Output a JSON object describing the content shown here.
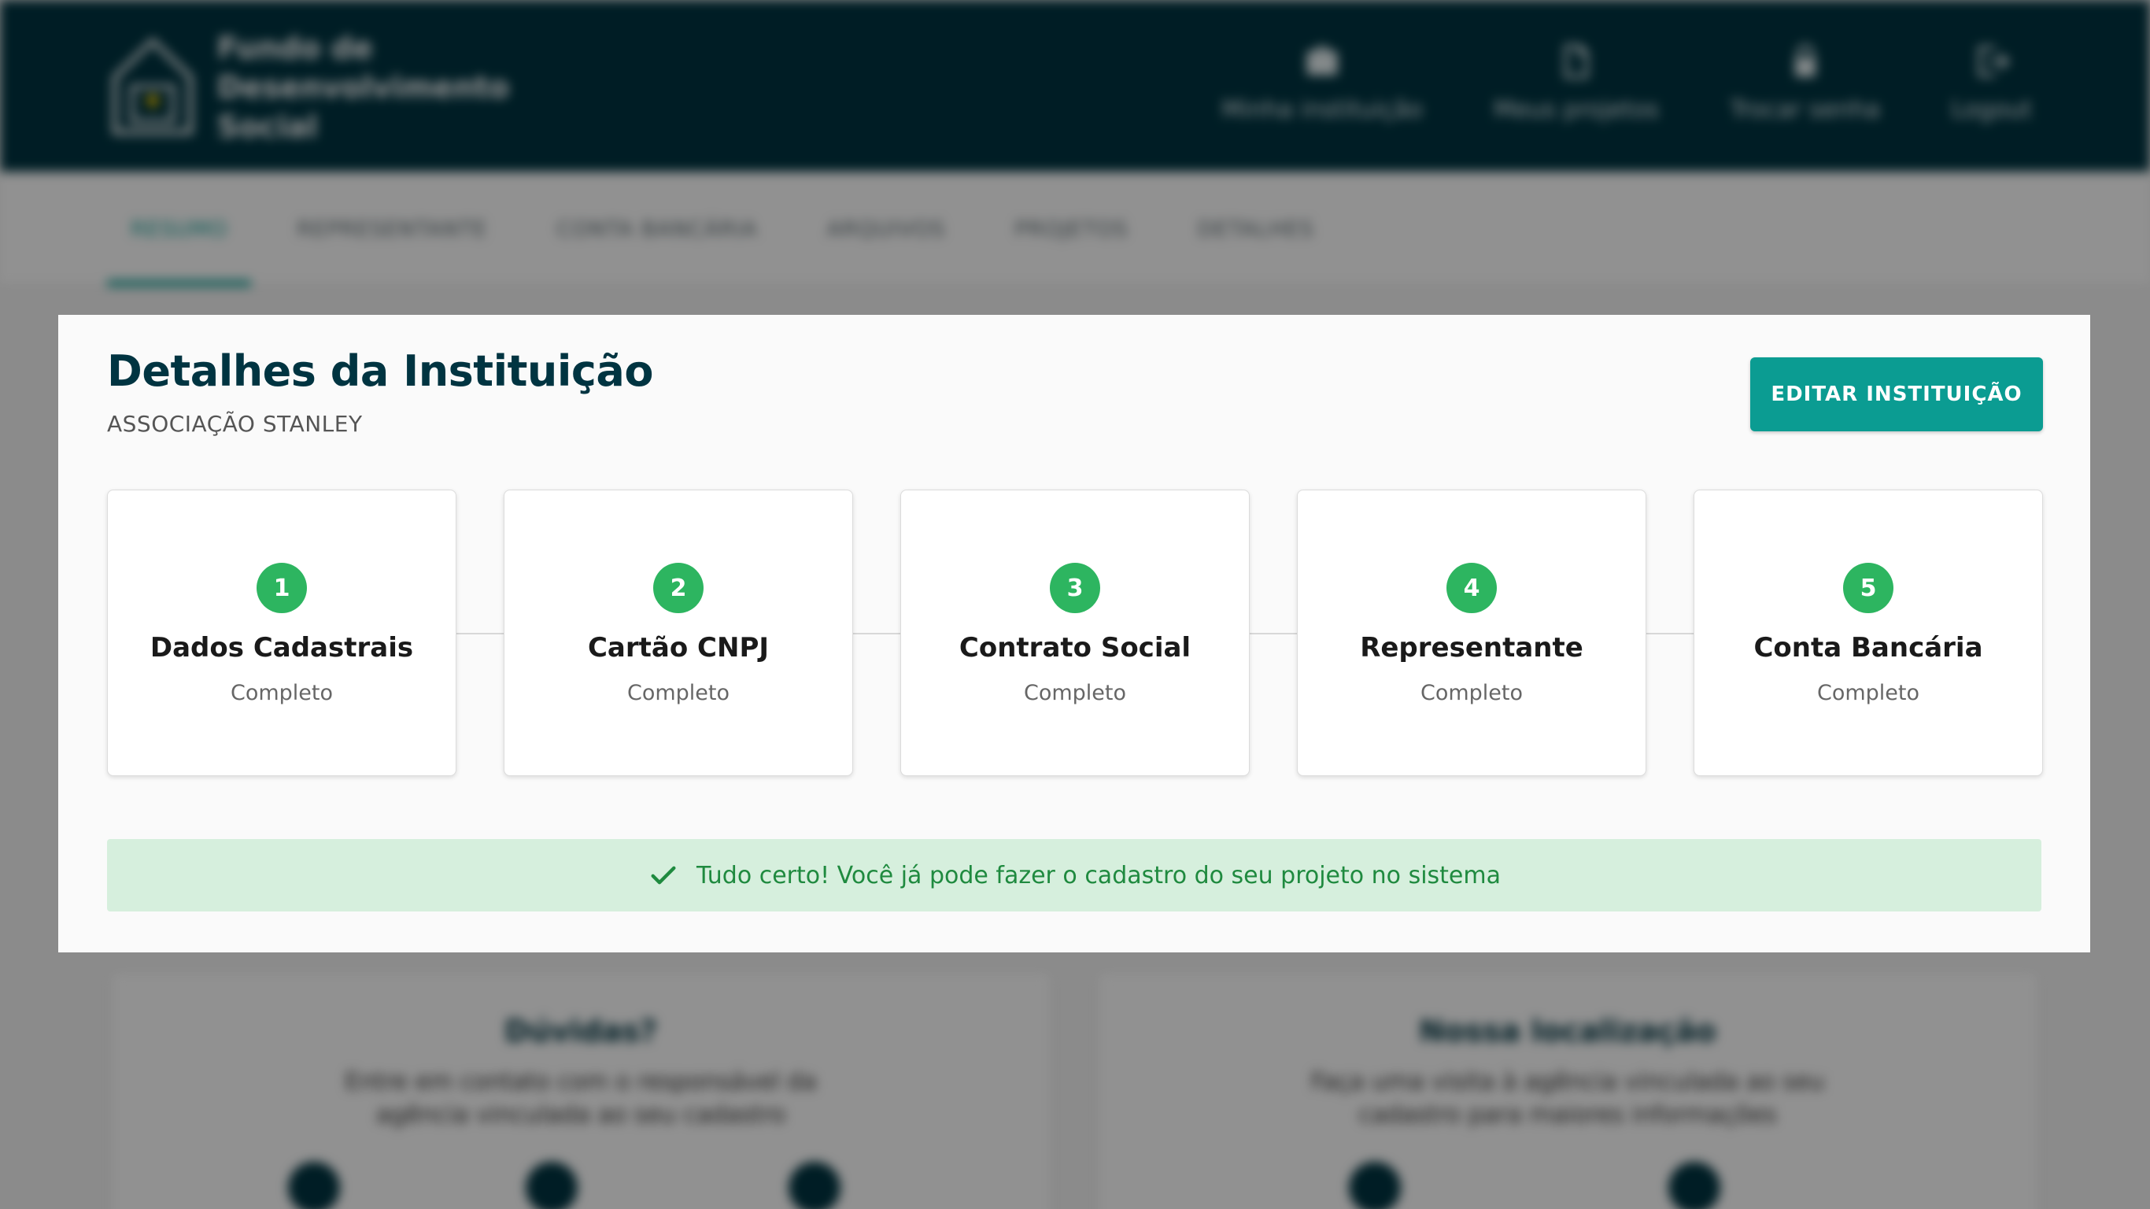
{
  "app": {
    "logo_text": "Fundo de Desenvolvimento Social",
    "top_nav": [
      {
        "label": "Minha instituição",
        "icon": "briefcase-icon"
      },
      {
        "label": "Meus projetos",
        "icon": "document-icon"
      },
      {
        "label": "Trocar senha",
        "icon": "lock-icon"
      },
      {
        "label": "Logout",
        "icon": "logout-icon"
      }
    ]
  },
  "tabs": [
    {
      "label": "Resumo",
      "active": true
    },
    {
      "label": "Representante",
      "active": false
    },
    {
      "label": "Conta bancária",
      "active": false
    },
    {
      "label": "Arquivos",
      "active": false
    },
    {
      "label": "Projetos",
      "active": false
    },
    {
      "label": "Detalhes",
      "active": false
    }
  ],
  "background_cards": {
    "help": {
      "title": "Dúvidas?",
      "text": "Entre em contato com o responsável da agência vinculada ao seu cadastro"
    },
    "location": {
      "title": "Nossa localização",
      "text": "Faça uma visita à agência vinculada ao seu cadastro para maiores informações"
    }
  },
  "modal": {
    "title": "Detalhes da Instituição",
    "subtitle": "ASSOCIAÇÃO STANLEY",
    "edit_button": "EDITAR INSTITUIÇÃO",
    "steps": [
      {
        "number": "1",
        "title": "Dados Cadastrais",
        "status": "Completo"
      },
      {
        "number": "2",
        "title": "Cartão CNPJ",
        "status": "Completo"
      },
      {
        "number": "3",
        "title": "Contrato Social",
        "status": "Completo"
      },
      {
        "number": "4",
        "title": "Representante",
        "status": "Completo"
      },
      {
        "number": "5",
        "title": "Conta Bancária",
        "status": "Completo"
      }
    ],
    "alert": "Tudo certo! Você já pode fazer o cadastro do seu projeto no sistema"
  },
  "colors": {
    "header_bg": "#003441",
    "accent": "#0b9c92",
    "step_badge": "#2db560",
    "alert_bg": "#d6efdd",
    "alert_text": "#1f8a3f"
  }
}
